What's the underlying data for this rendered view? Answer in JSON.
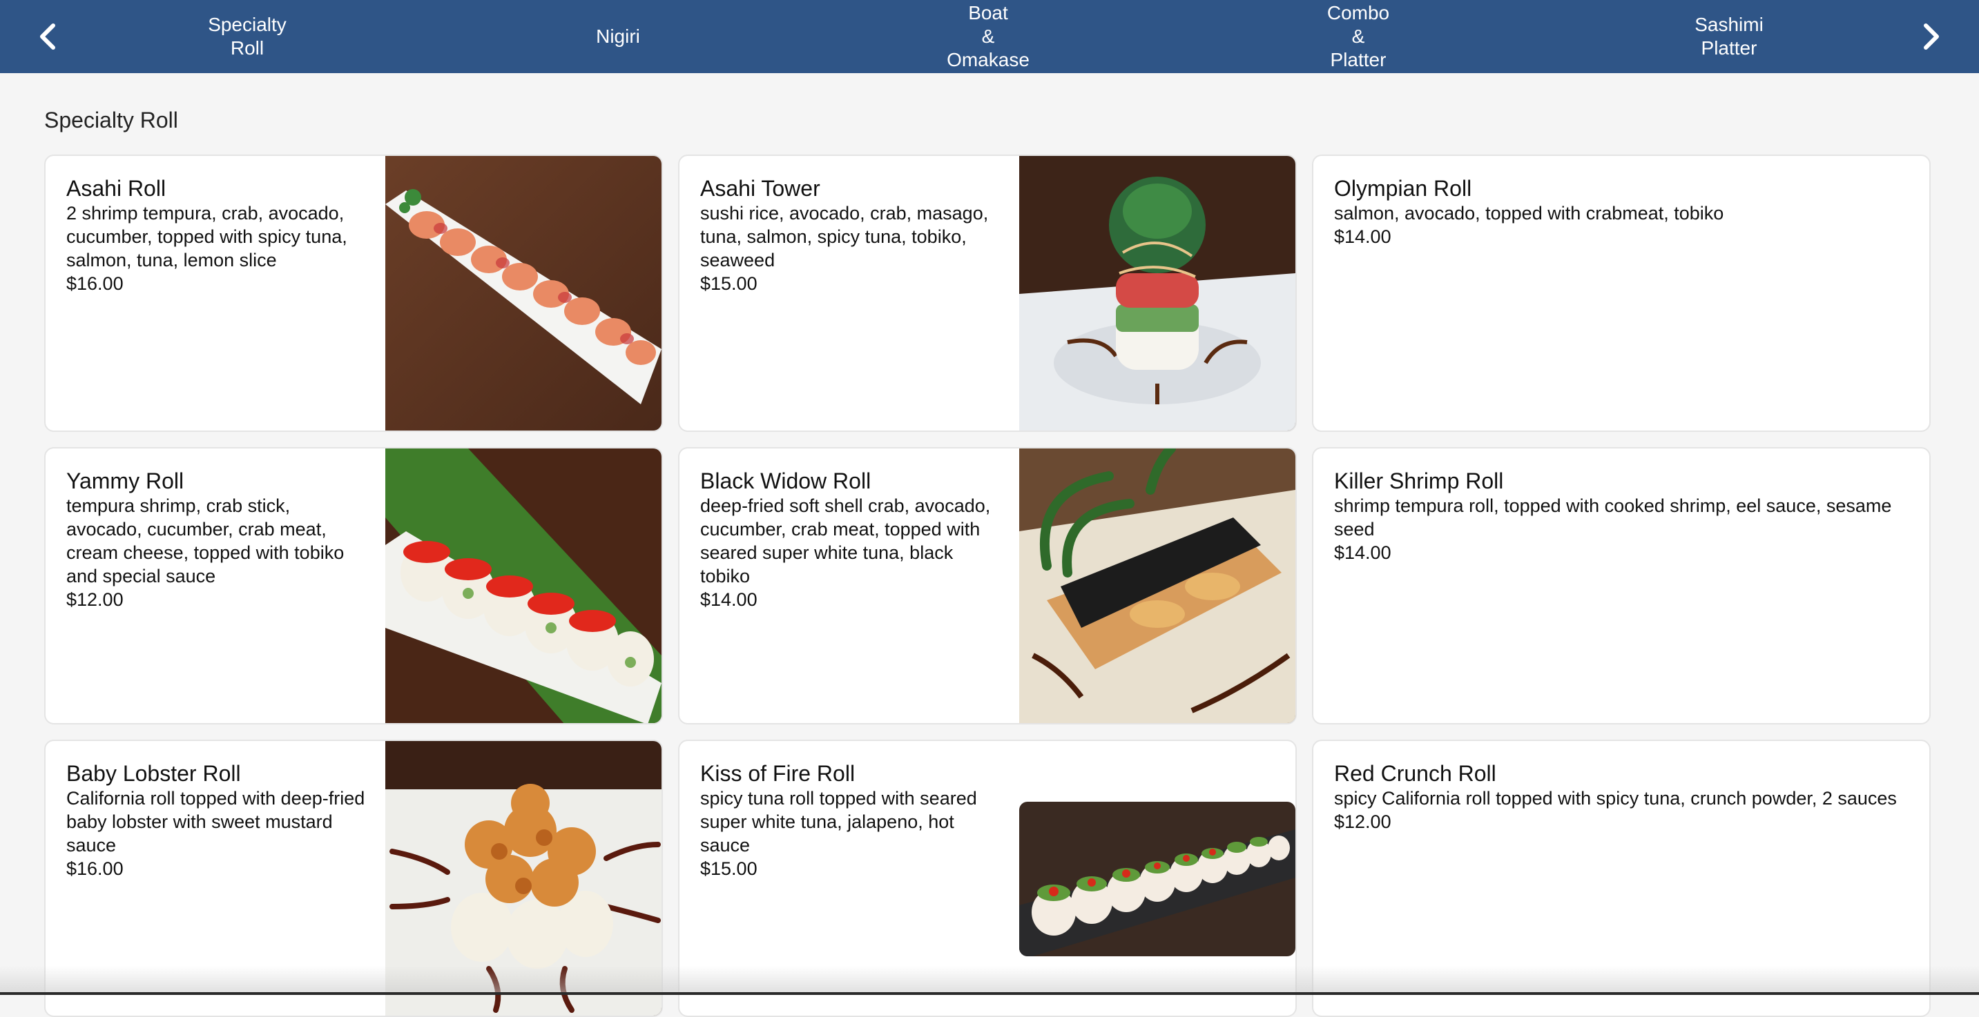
{
  "nav": {
    "prev_icon": "chevron-left-icon",
    "next_icon": "chevron-right-icon",
    "tabs": [
      {
        "label": "Specialty\nRoll"
      },
      {
        "label": "Nigiri"
      },
      {
        "label": "Boat\n&\nOmakase"
      },
      {
        "label": "Combo\n&\nPlatter"
      },
      {
        "label": "Sashimi\nPlatter"
      }
    ]
  },
  "colors": {
    "header": "#2f5587",
    "card_border": "#e4e4e4",
    "background": "#f5f5f5"
  },
  "section": {
    "title": "Specialty Roll"
  },
  "items": [
    {
      "name": "Asahi Roll",
      "description": "2 shrimp tempura, crab, avocado, cucumber, topped with spicy tuna, salmon, tuna, lemon slice",
      "price": "$16.00",
      "image": "asahi-roll-photo"
    },
    {
      "name": "Asahi Tower",
      "description": "sushi rice, avocado, crab, masago, tuna, salmon, spicy tuna, tobiko, seaweed",
      "price": "$15.00",
      "image": "asahi-tower-photo"
    },
    {
      "name": "Olympian Roll",
      "description": "salmon, avocado, topped with crabmeat, tobiko",
      "price": "$14.00"
    },
    {
      "name": "Yammy Roll",
      "description": "tempura shrimp, crab stick, avocado, cucumber, crab meat, cream cheese, topped with tobiko and special sauce",
      "price": "$12.00",
      "image": "yammy-roll-photo"
    },
    {
      "name": "Black Widow Roll",
      "description": "deep-fried soft shell crab, avocado, cucumber, crab meat, topped with seared super white tuna, black tobiko",
      "price": "$14.00",
      "image": "black-widow-roll-photo"
    },
    {
      "name": "Killer Shrimp Roll",
      "description": "shrimp tempura roll, topped with cooked shrimp, eel sauce, sesame seed",
      "price": "$14.00"
    },
    {
      "name": "Baby Lobster Roll",
      "description": "California roll topped with deep-fried baby lobster with sweet mustard sauce",
      "price": "$16.00",
      "image": "baby-lobster-roll-photo"
    },
    {
      "name": "Kiss of Fire Roll",
      "description": "spicy tuna roll topped with seared super white tuna, jalapeno, hot sauce",
      "price": "$15.00",
      "image": "kiss-of-fire-roll-photo"
    },
    {
      "name": "Red Crunch Roll",
      "description": "spicy California roll topped with spicy tuna, crunch powder, 2 sauces",
      "price": "$12.00"
    }
  ]
}
